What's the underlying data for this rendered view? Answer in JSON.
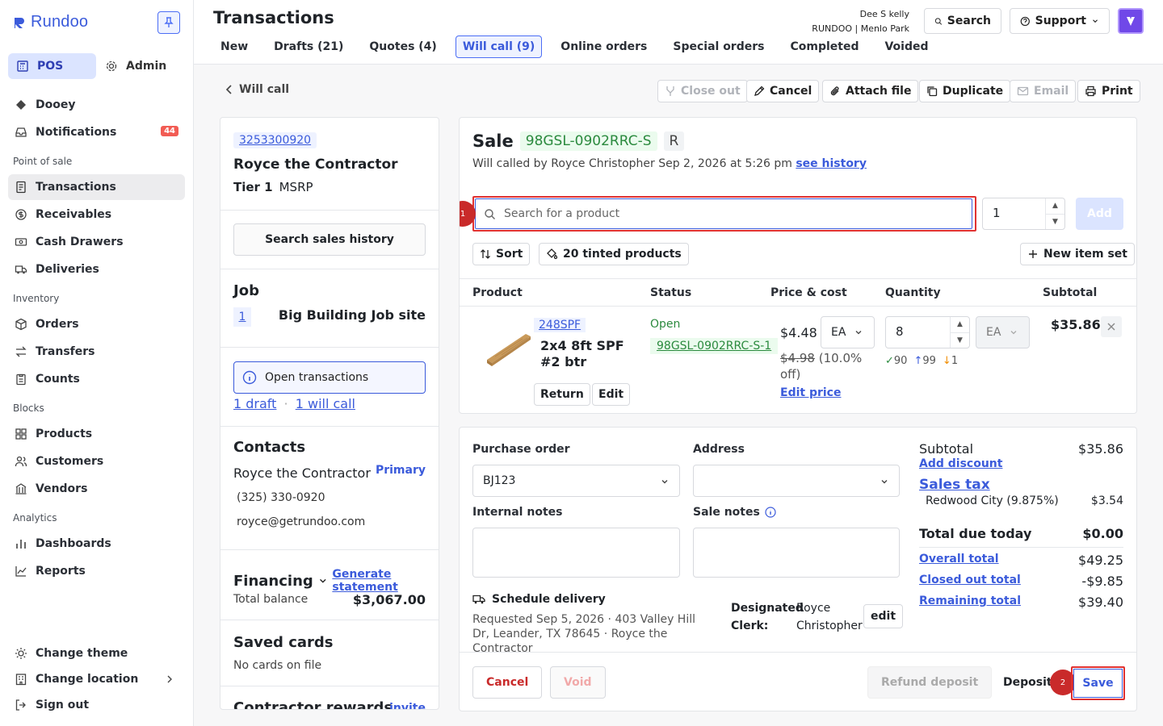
{
  "app": {
    "name": "Rundoo"
  },
  "sidebar": {
    "modes": [
      {
        "label": "POS"
      },
      {
        "label": "Admin"
      }
    ],
    "top_items": [
      {
        "label": "Dooey"
      },
      {
        "label": "Notifications",
        "badge": "44"
      }
    ],
    "sections": [
      {
        "title": "Point of sale",
        "items": [
          {
            "label": "Transactions"
          },
          {
            "label": "Receivables"
          },
          {
            "label": "Cash Drawers"
          },
          {
            "label": "Deliveries"
          }
        ]
      },
      {
        "title": "Inventory",
        "items": [
          {
            "label": "Orders"
          },
          {
            "label": "Transfers"
          },
          {
            "label": "Counts"
          }
        ]
      },
      {
        "title": "Blocks",
        "items": [
          {
            "label": "Products"
          },
          {
            "label": "Customers"
          },
          {
            "label": "Vendors"
          }
        ]
      },
      {
        "title": "Analytics",
        "items": [
          {
            "label": "Dashboards"
          },
          {
            "label": "Reports"
          }
        ]
      }
    ],
    "bottom_items": [
      {
        "label": "Change theme"
      },
      {
        "label": "Change location"
      },
      {
        "label": "Sign out"
      }
    ]
  },
  "header": {
    "title": "Transactions",
    "tabs": [
      {
        "label": "New"
      },
      {
        "label": "Drafts (21)"
      },
      {
        "label": "Quotes (4)"
      },
      {
        "label": "Will call (9)",
        "active": true
      },
      {
        "label": "Online orders"
      },
      {
        "label": "Special orders"
      },
      {
        "label": "Completed"
      },
      {
        "label": "Voided"
      }
    ],
    "user_name": "Dee S kelly",
    "store": "RUNDOO | Menlo Park",
    "search_label": "Search",
    "support_label": "Support"
  },
  "toolbar": {
    "back_label": "Will call",
    "close_out": "Close out",
    "cancel": "Cancel",
    "attach": "Attach file",
    "duplicate": "Duplicate",
    "email": "Email",
    "print": "Print"
  },
  "customer": {
    "phone": "3253300920",
    "name": "Royce the Contractor",
    "tier": "Tier 1",
    "pricing": "MSRP",
    "search_history": "Search sales history",
    "job_title": "Job",
    "job_number": "1",
    "job_site": "Big Building Job site",
    "open_transactions": "Open transactions",
    "draft_link": "1 draft",
    "separator": "·",
    "will_call_link": "1 will call",
    "contacts_title": "Contacts",
    "contact_name": "Royce the Contractor",
    "primary": "Primary",
    "contact_phone": "(325) 330-0920",
    "contact_email": "royce@getrundoo.com",
    "financing_title": "Financing",
    "generate_statement": "Generate statement",
    "total_balance_label": "Total balance",
    "total_balance": "$3,067.00",
    "saved_cards_title": "Saved cards",
    "saved_cards_text": "No cards on file",
    "rewards_title": "Contractor rewards",
    "invite": "invite"
  },
  "sale": {
    "title": "Sale",
    "id": "98GSL-0902RRC-S",
    "tag": "R",
    "subtitle": "Will called by Royce Christopher Sep 2, 2026 at 5:26 pm",
    "see_history": "see history",
    "search_placeholder": "Search for a product",
    "quantity": "1",
    "add": "Add",
    "sort": "Sort",
    "tinted": "20 tinted products",
    "new_item_set": "New item set",
    "columns": {
      "product": "Product",
      "status": "Status",
      "price": "Price & cost",
      "quantity": "Quantity",
      "subtotal": "Subtotal"
    },
    "line": {
      "sku": "248SPF",
      "name": "2x4 8ft SPF #2 btr",
      "return": "Return",
      "edit": "Edit",
      "status": "Open",
      "status_id": "98GSL-0902RRC-S-1",
      "price": "$4.48",
      "unit": "EA",
      "old_price": "$4.98",
      "discount": "(10.0% off)",
      "edit_price": "Edit price",
      "qty": "8",
      "qty_unit": "EA",
      "inv_ok": "90",
      "inv_up": "99",
      "inv_down": "1",
      "subtotal": "$35.86"
    }
  },
  "details": {
    "po_label": "Purchase order",
    "po_value": "BJ123",
    "address_label": "Address",
    "internal_notes_label": "Internal notes",
    "sale_notes_label": "Sale notes",
    "schedule_delivery": "Schedule delivery",
    "delivery_text": "Requested Sep 5, 2026 · 403 Valley Hill Dr, Leander, TX 78645 · Royce the Contractor",
    "clerk_label": "Designated Clerk:",
    "clerk_name": "Royce Christopher",
    "clerk_edit": "edit",
    "summary": {
      "subtotal_label": "Subtotal",
      "subtotal": "$35.86",
      "add_discount": "Add discount",
      "sales_tax": "Sales tax",
      "tax_region": "Redwood City (9.875%)",
      "tax": "$3.54",
      "total_due_label": "Total due today",
      "total_due": "$0.00",
      "overall_label": "Overall total",
      "overall": "$49.25",
      "closed_label": "Closed out total",
      "closed": "-$9.85",
      "remaining_label": "Remaining total",
      "remaining": "$39.40"
    },
    "footer": {
      "cancel": "Cancel",
      "void": "Void",
      "refund": "Refund deposit",
      "deposit": "Deposit",
      "save": "Save"
    }
  },
  "markers": [
    "1",
    "2"
  ],
  "colors": {
    "accent": "#3b5bdb",
    "danger": "#e03131",
    "success": "#2b8a3e",
    "badge": "#f25c54"
  }
}
